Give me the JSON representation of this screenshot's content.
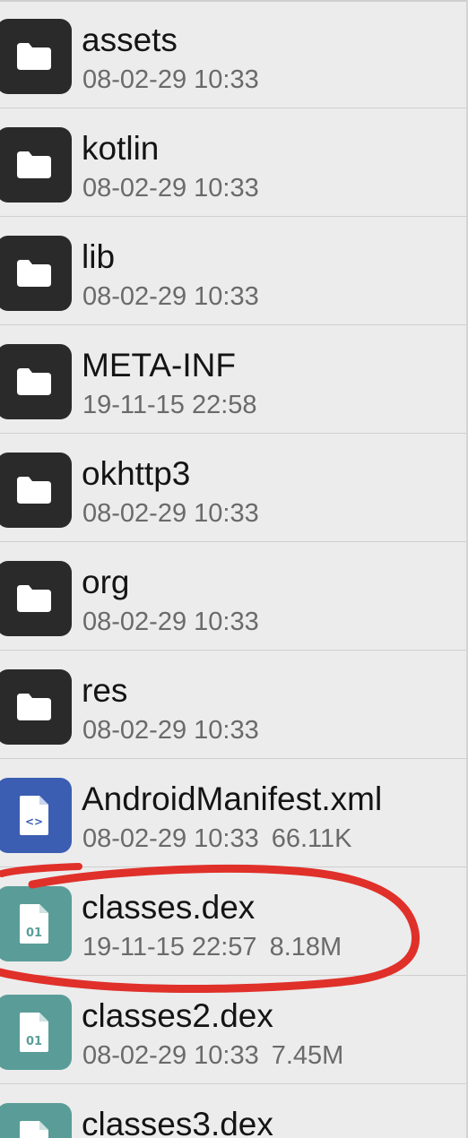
{
  "files": [
    {
      "name": "assets",
      "date": "08-02-29 10:33",
      "size": "",
      "icon": "folder-icon"
    },
    {
      "name": "kotlin",
      "date": "08-02-29 10:33",
      "size": "",
      "icon": "folder-icon"
    },
    {
      "name": "lib",
      "date": "08-02-29 10:33",
      "size": "",
      "icon": "folder-icon"
    },
    {
      "name": "META-INF",
      "date": "19-11-15 22:58",
      "size": "",
      "icon": "folder-icon"
    },
    {
      "name": "okhttp3",
      "date": "08-02-29 10:33",
      "size": "",
      "icon": "folder-icon"
    },
    {
      "name": "org",
      "date": "08-02-29 10:33",
      "size": "",
      "icon": "folder-icon"
    },
    {
      "name": "res",
      "date": "08-02-29 10:33",
      "size": "",
      "icon": "folder-icon"
    },
    {
      "name": "AndroidManifest.xml",
      "date": "08-02-29 10:33",
      "size": "66.11K",
      "icon": "xml-file-icon"
    },
    {
      "name": "classes.dex",
      "date": "19-11-15 22:57",
      "size": "8.18M",
      "icon": "dex-file-icon"
    },
    {
      "name": "classes2.dex",
      "date": "08-02-29 10:33",
      "size": "7.45M",
      "icon": "dex-file-icon"
    },
    {
      "name": "classes3.dex",
      "date": "",
      "size": "",
      "icon": "dex-file-icon"
    }
  ],
  "icons": {
    "xml_glyph": "<>",
    "dex_glyph": "01"
  },
  "colors": {
    "folder_icon_bg": "#2a2a2a",
    "xml_icon_bg": "#3b5eb3",
    "dex_icon_bg": "#5a9d98",
    "annotation_stroke": "#e0302a"
  }
}
